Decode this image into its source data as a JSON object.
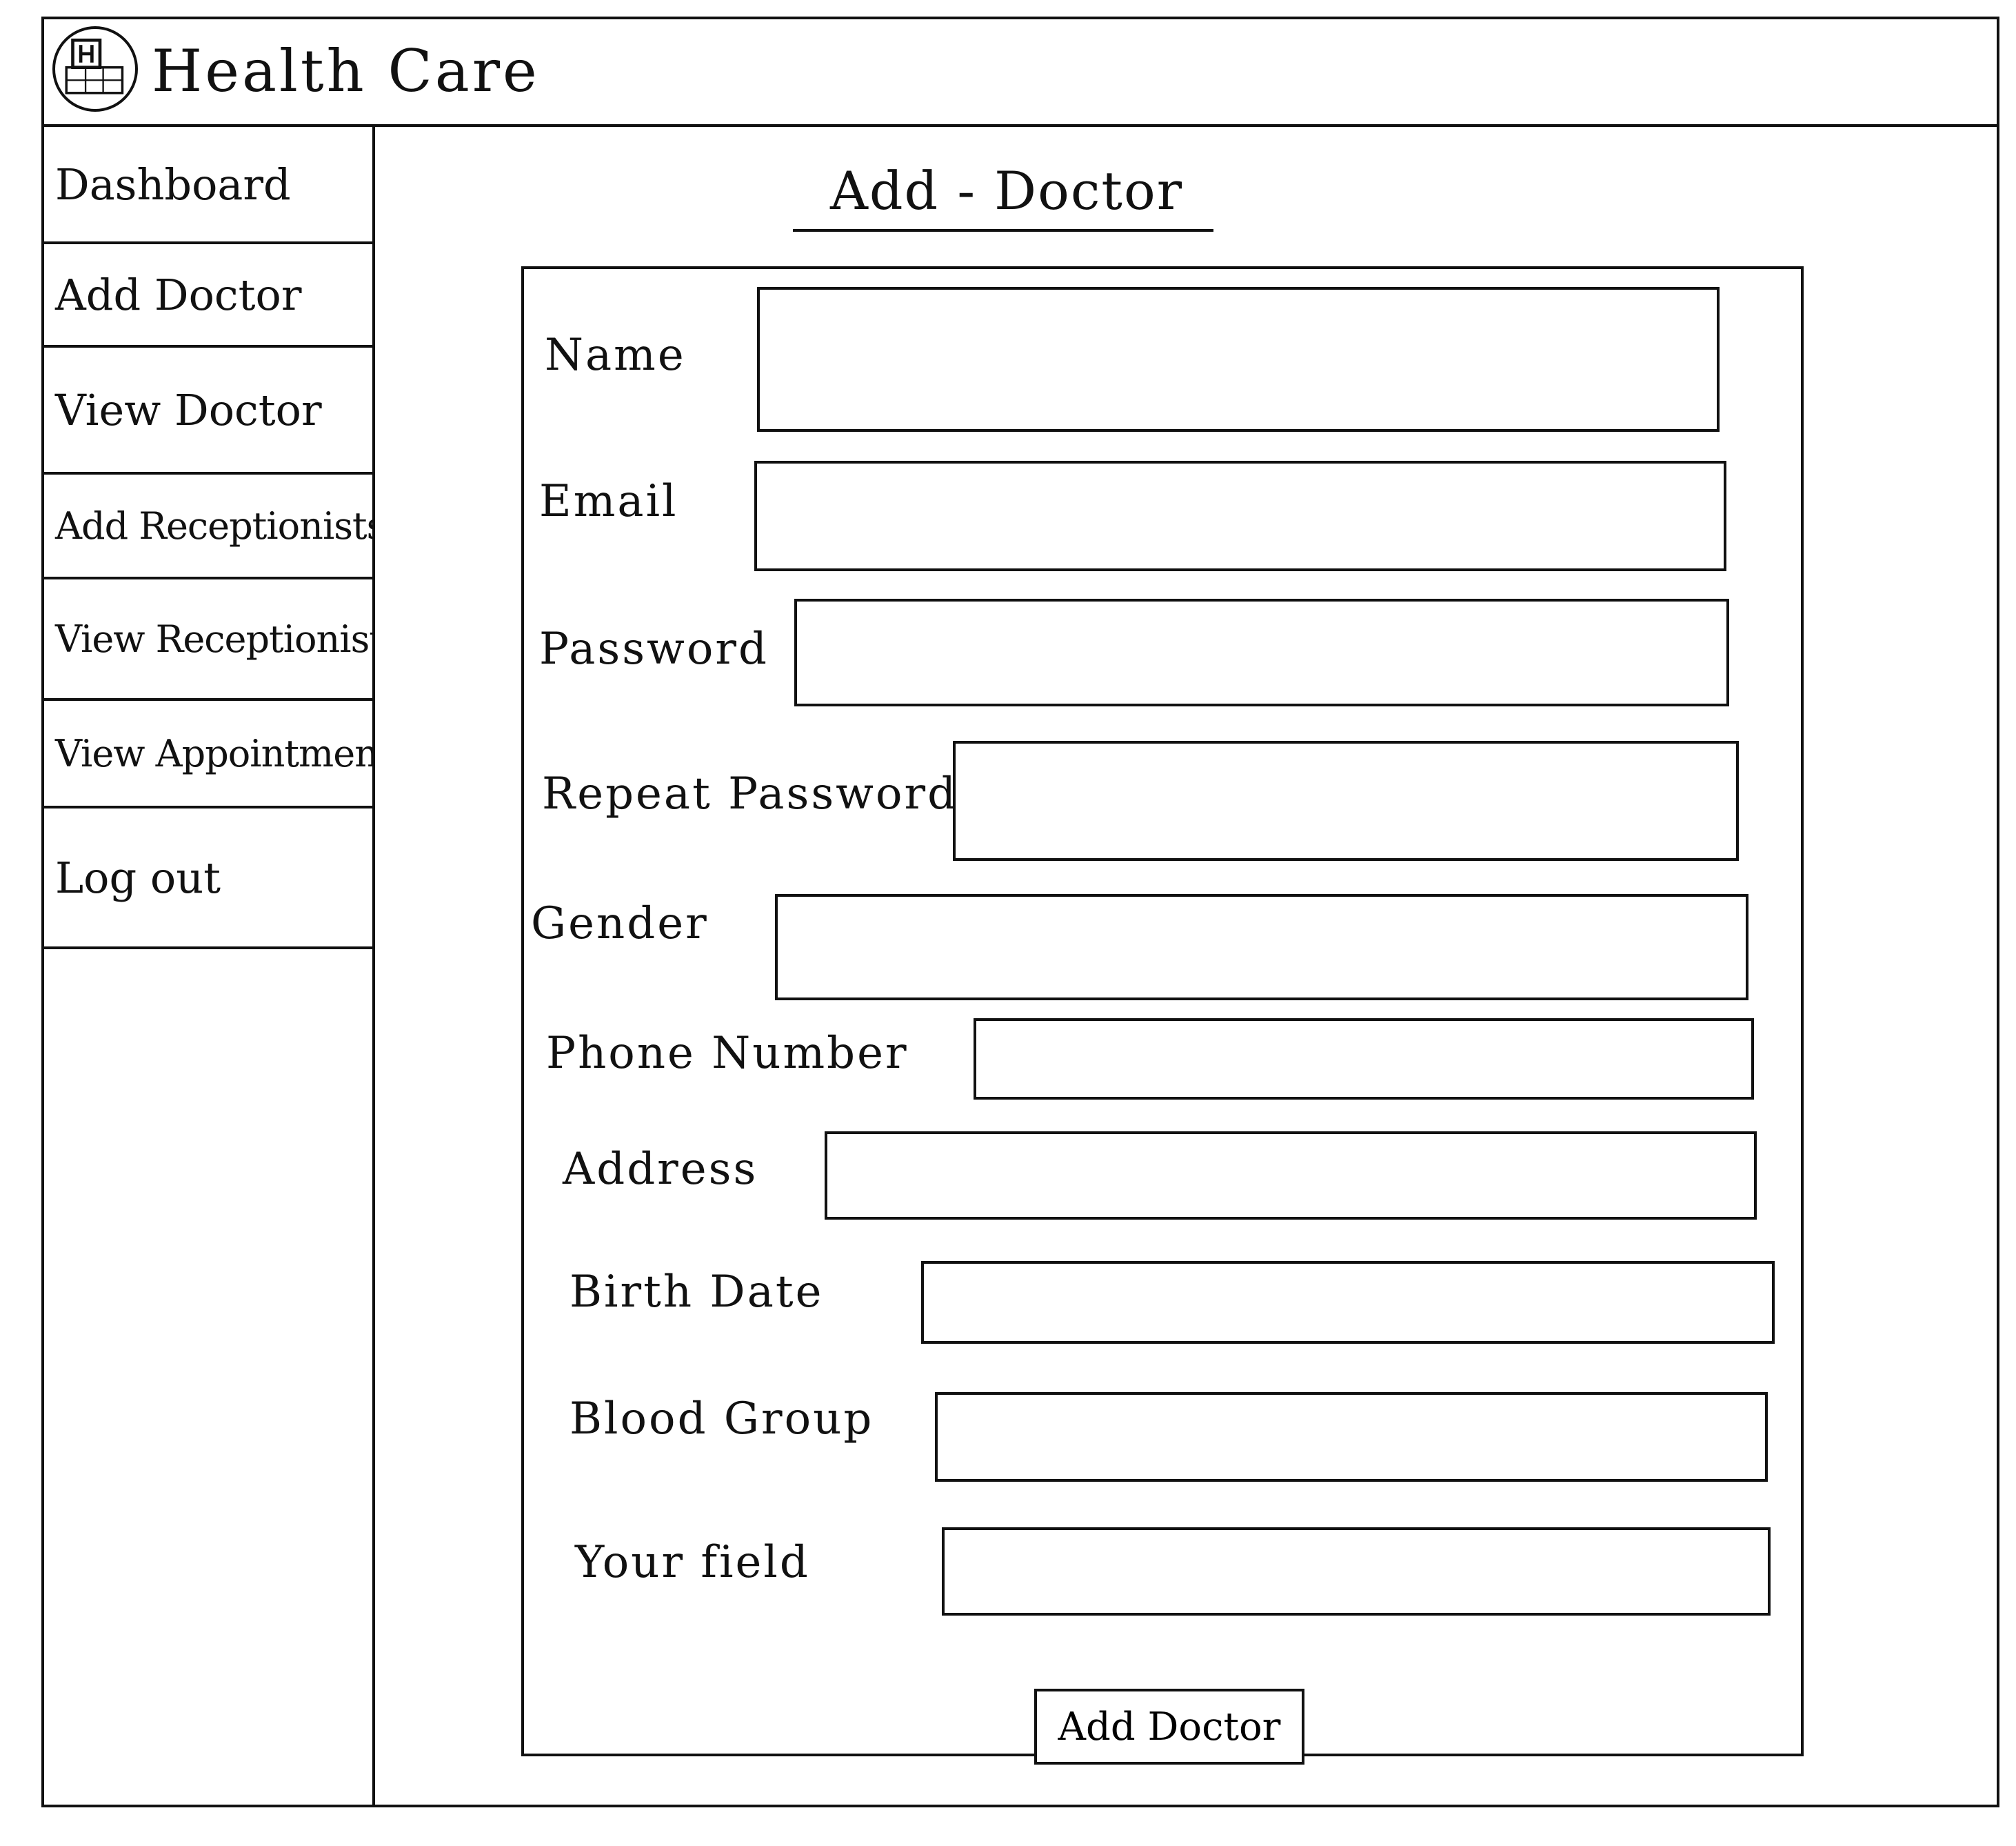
{
  "app": {
    "title": "Health Care",
    "logo_icon": "hospital-logo-icon"
  },
  "sidebar": {
    "items": [
      {
        "label": "Dashboard"
      },
      {
        "label": "Add Doctor"
      },
      {
        "label": "View Doctor"
      },
      {
        "label": "Add Receptionists"
      },
      {
        "label": "View Receptionist"
      },
      {
        "label": "View Appointments"
      },
      {
        "label": "Log out"
      }
    ]
  },
  "main": {
    "title": "Add - Doctor",
    "fields": [
      {
        "label": "Name",
        "value": ""
      },
      {
        "label": "Email",
        "value": ""
      },
      {
        "label": "Password",
        "value": ""
      },
      {
        "label": "Repeat Password",
        "value": ""
      },
      {
        "label": "Gender",
        "value": ""
      },
      {
        "label": "Phone Number",
        "value": ""
      },
      {
        "label": "Address",
        "value": ""
      },
      {
        "label": "Birth Date",
        "value": ""
      },
      {
        "label": "Blood Group",
        "value": ""
      },
      {
        "label": "Your field",
        "value": ""
      }
    ],
    "submit_label": "Add Doctor"
  }
}
